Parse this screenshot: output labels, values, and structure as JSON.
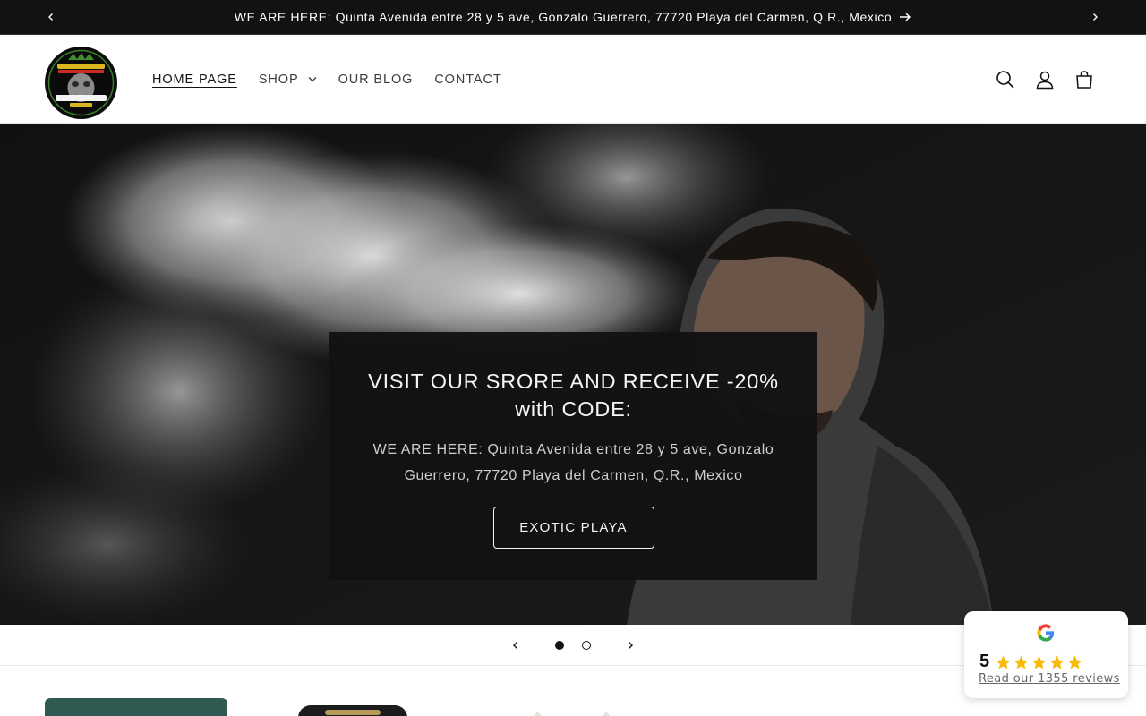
{
  "announcement": {
    "text": "WE ARE HERE: Quinta Avenida entre 28 y 5 ave, Gonzalo Guerrero, 77720 Playa del Carmen, Q.R., Mexico",
    "prev_icon": "chevron-left-icon",
    "next_icon": "chevron-right-icon",
    "arrow_icon": "arrow-right-icon"
  },
  "header": {
    "logo_alt": "Playa del Carmen Smoke Shop Mexico",
    "nav": [
      {
        "label": "HOME PAGE",
        "active": true
      },
      {
        "label": "SHOP",
        "has_dropdown": true
      },
      {
        "label": "OUR BLOG"
      },
      {
        "label": "CONTACT"
      }
    ],
    "icons": [
      "search-icon",
      "account-icon",
      "cart-icon"
    ]
  },
  "hero": {
    "title": "VISIT OUR SRORE AND RECEIVE -20% with CODE:",
    "text": "WE ARE HERE: Quinta Avenida entre 28 y 5 ave, Gonzalo Guerrero, 77720 Playa del Carmen, Q.R., Mexico",
    "button": "EXOTIC PLAYA"
  },
  "slider": {
    "slide_count": 2,
    "current_slide": 1
  },
  "reviews_widget": {
    "rating": "5",
    "stars": 5,
    "link_text": "Read our 1355 reviews",
    "star_color": "#f6bb06"
  },
  "colors": {
    "dark": "#121212",
    "announcement_bg": "#121212"
  }
}
